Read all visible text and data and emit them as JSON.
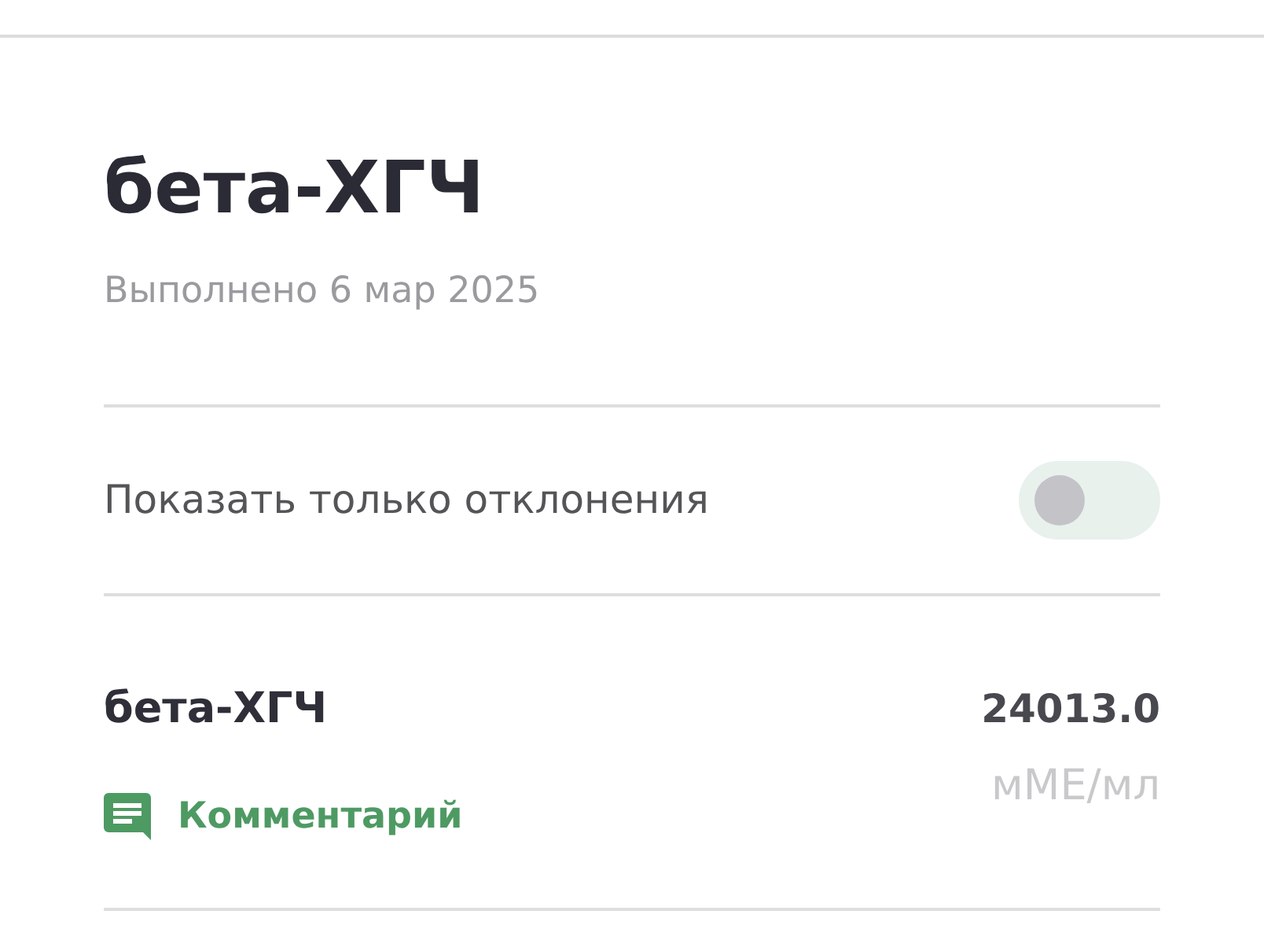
{
  "title": "бета-ХГЧ",
  "subtitle": "Выполнено 6 мар 2025",
  "filter": {
    "label": "Показать только отклонения",
    "on": false
  },
  "results": [
    {
      "name": "бета-ХГЧ",
      "value": "24013.0",
      "unit": "мМЕ/мл",
      "comment": "Комментарий"
    }
  ]
}
